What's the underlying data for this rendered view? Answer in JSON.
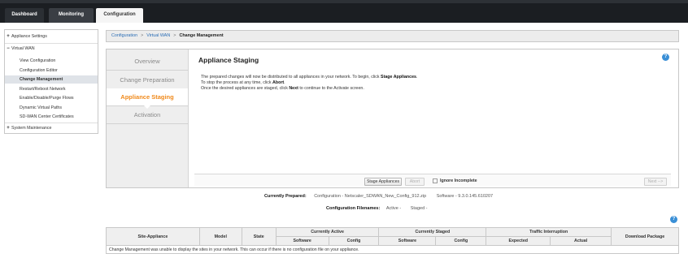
{
  "nav": {
    "tabs": [
      {
        "label": "Dashboard"
      },
      {
        "label": "Monitoring"
      },
      {
        "label": "Configuration"
      }
    ]
  },
  "tree": {
    "appliance_settings": "Appliance Settings",
    "virtual_wan": "Virtual WAN",
    "items": [
      {
        "label": "View Configuration"
      },
      {
        "label": "Configuration Editor"
      },
      {
        "label": "Change Management"
      },
      {
        "label": "Restart/Reboot Network"
      },
      {
        "label": "Enable/Disable/Purge Flows"
      },
      {
        "label": "Dynamic Virtual Paths"
      },
      {
        "label": "SD-WAN Center Certificates"
      }
    ],
    "system_maintenance": "System Maintenance",
    "plus": "+",
    "minus": "−"
  },
  "breadcrumb": {
    "items": [
      "Configuration",
      "Virtual WAN",
      "Change Management"
    ],
    "separator": ">"
  },
  "steps": [
    {
      "label": "Overview"
    },
    {
      "label": "Change Preparation"
    },
    {
      "label": "Appliance Staging"
    },
    {
      "label": "Activation"
    }
  ],
  "staging": {
    "title": "Appliance Staging",
    "line1_a": "The prepared changes will now be distributed to all appliances in your network. To begin, click ",
    "line1_b": "Stage Appliances",
    "line1_c": ".",
    "line2_a": "To stop the process at any time, click ",
    "line2_b": "Abort",
    "line2_c": ".",
    "line3_a": "Once the desired appliances are staged, click ",
    "line3_b": "Next",
    "line3_c": " to continue to the Activate screen.",
    "stage_button": "Stage Appliances",
    "abort_button": "Abort",
    "ignore_label": "Ignore Incomplete",
    "next_button": "Next -->"
  },
  "help_label": "?",
  "prepared": {
    "label": "Currently Prepared:",
    "config": "Configuration - Netscaler_SDWAN_New_Config_912.zip",
    "software": "Software - 9.3.0.145.610207"
  },
  "filenames": {
    "label": "Configuration Filenames:",
    "active": "Active -",
    "staged": "Staged -"
  },
  "table": {
    "headers": {
      "site_appliance": "Site-Appliance",
      "model": "Model",
      "state": "State",
      "currently_active": "Currently Active",
      "currently_staged": "Currently Staged",
      "traffic_interruption": "Traffic Interruption",
      "download_package": "Download Package",
      "software": "Software",
      "config": "Config",
      "expected": "Expected",
      "actual": "Actual"
    },
    "empty_message": "Change Management was unable to display the sites in your network. This can occur if there is no configuration file on your appliance."
  },
  "colors": {
    "accent_orange": "#f08a1c",
    "link_blue": "#2a6db5",
    "help_blue": "#3a8fd6",
    "topbar": "#1b1e22"
  }
}
